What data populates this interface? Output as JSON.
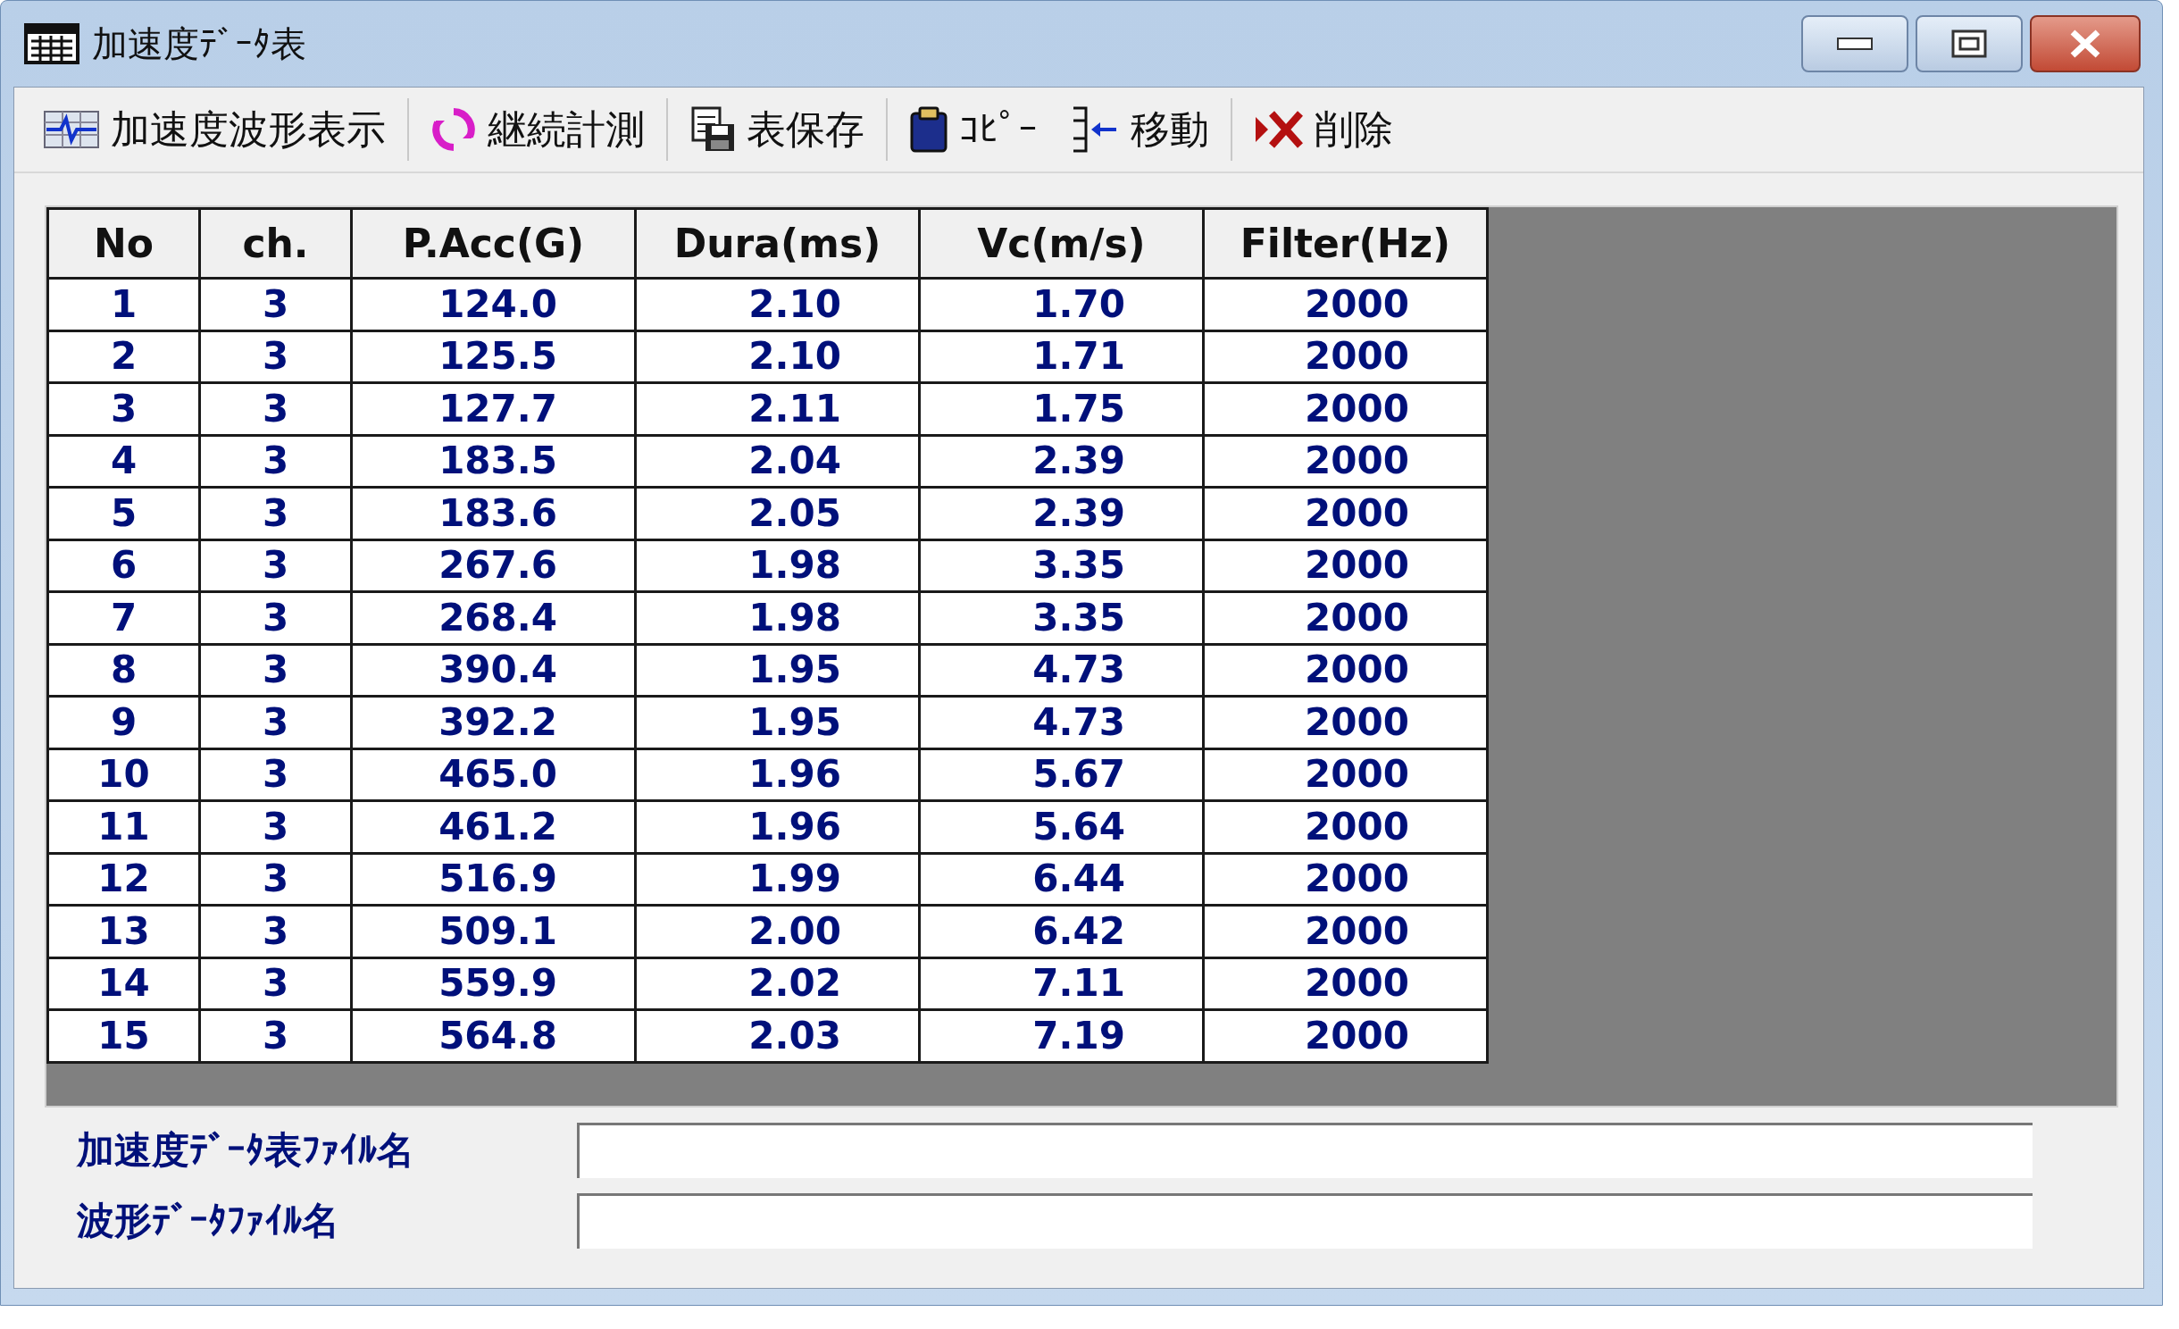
{
  "window": {
    "title": "加速度ﾃﾞｰﾀ表"
  },
  "toolbar": [
    {
      "kind": "wave",
      "label": "加速度波形表示"
    },
    {
      "kind": "cycle",
      "label": "継続計測"
    },
    {
      "kind": "save",
      "label": "表保存"
    },
    {
      "kind": "copy",
      "label": "ｺﾋﾟｰ"
    },
    {
      "kind": "move",
      "label": "移動"
    },
    {
      "kind": "delete",
      "label": "削除"
    }
  ],
  "table": {
    "columns": [
      "No",
      "ch.",
      "P.Acc(G)",
      "Dura(ms)",
      "Vc(m/s)",
      "Filter(Hz)"
    ],
    "rows": [
      [
        "1",
        "3",
        "124.0",
        "2.10",
        "1.70",
        "2000"
      ],
      [
        "2",
        "3",
        "125.5",
        "2.10",
        "1.71",
        "2000"
      ],
      [
        "3",
        "3",
        "127.7",
        "2.11",
        "1.75",
        "2000"
      ],
      [
        "4",
        "3",
        "183.5",
        "2.04",
        "2.39",
        "2000"
      ],
      [
        "5",
        "3",
        "183.6",
        "2.05",
        "2.39",
        "2000"
      ],
      [
        "6",
        "3",
        "267.6",
        "1.98",
        "3.35",
        "2000"
      ],
      [
        "7",
        "3",
        "268.4",
        "1.98",
        "3.35",
        "2000"
      ],
      [
        "8",
        "3",
        "390.4",
        "1.95",
        "4.73",
        "2000"
      ],
      [
        "9",
        "3",
        "392.2",
        "1.95",
        "4.73",
        "2000"
      ],
      [
        "10",
        "3",
        "465.0",
        "1.96",
        "5.67",
        "2000"
      ],
      [
        "11",
        "3",
        "461.2",
        "1.96",
        "5.64",
        "2000"
      ],
      [
        "12",
        "3",
        "516.9",
        "1.99",
        "6.44",
        "2000"
      ],
      [
        "13",
        "3",
        "509.1",
        "2.00",
        "6.42",
        "2000"
      ],
      [
        "14",
        "3",
        "559.9",
        "2.02",
        "7.11",
        "2000"
      ],
      [
        "15",
        "3",
        "564.8",
        "2.03",
        "7.19",
        "2000"
      ]
    ]
  },
  "fields": [
    {
      "label": "加速度ﾃﾞｰﾀ表ﾌｧｲﾙ名"
    },
    {
      "label": "波形ﾃﾞｰﾀﾌｧｲﾙ名"
    }
  ]
}
